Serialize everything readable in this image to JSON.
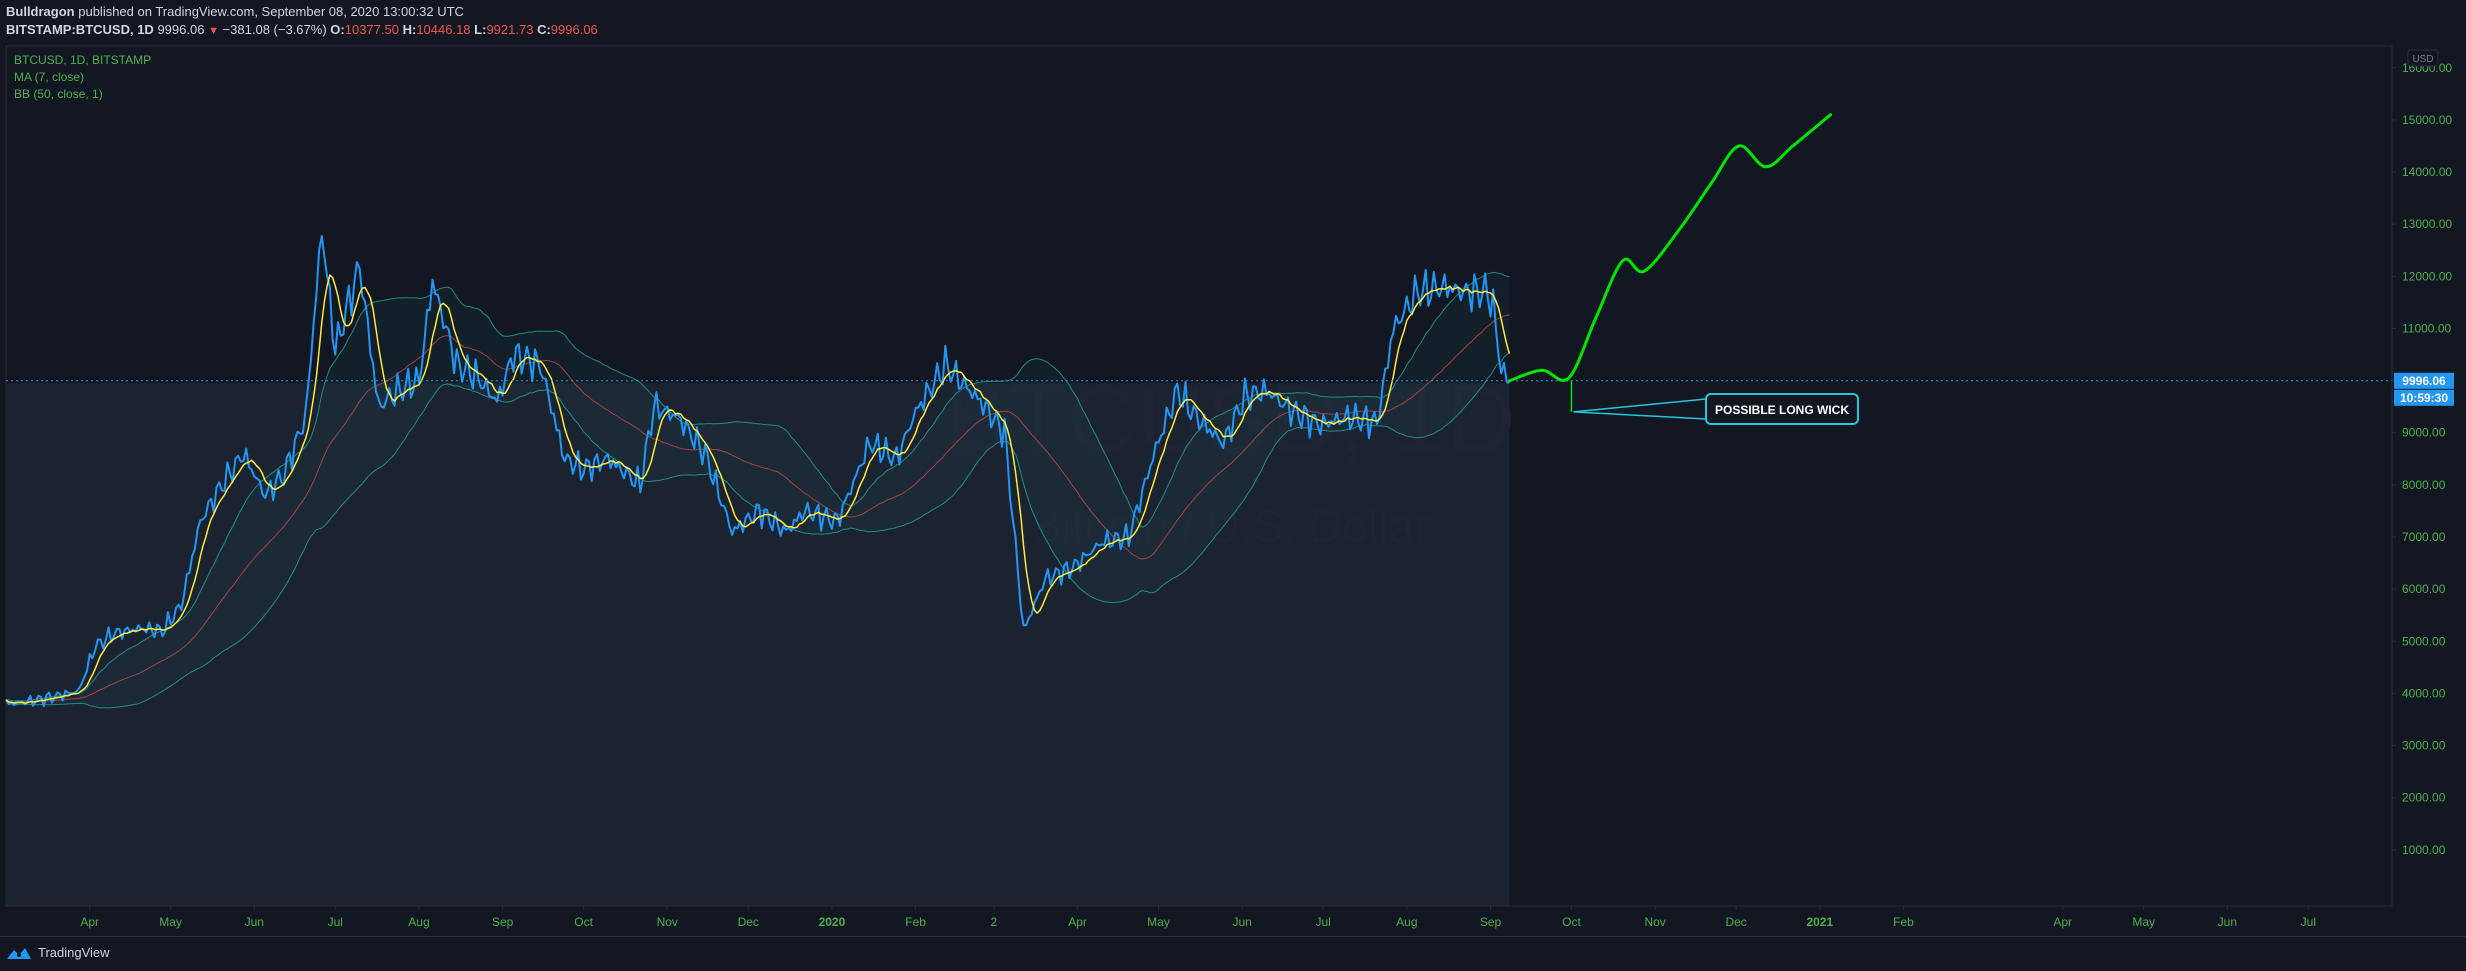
{
  "header": {
    "author": "Bulldragon",
    "published_text": "published on TradingView.com, September 08, 2020 13:00:32 UTC",
    "symbol": "BITSTAMP:BTCUSD, 1D",
    "last": "9996.06",
    "change": "−381.08 (−3.67%)",
    "o_label": "O:",
    "o_value": "10377.50",
    "h_label": "H:",
    "h_value": "10446.18",
    "l_label": "L:",
    "l_value": "9921.73",
    "c_label": "C:",
    "c_value": "9996.06"
  },
  "legend": {
    "line1": "BTCUSD, 1D, BITSTAMP",
    "line2": "MA (7, close)",
    "line3": "BB (50, close, 1)"
  },
  "watermark": {
    "symbol": "BTCUSD, 1D",
    "description": "Bitcoin / U.S. Dollar"
  },
  "annotation": {
    "label": "POSSIBLE LONG WICK"
  },
  "price_badge": {
    "price": "9996.06",
    "countdown": "10:59:30"
  },
  "currency": "USD",
  "footer": {
    "brand": "TradingView"
  },
  "colors": {
    "background": "#131722",
    "price_line": "#2196f3",
    "ma_line": "#ffeb3b",
    "bb_band": "#26a69a",
    "bb_basis": "#b24646",
    "projection": "#00e600",
    "axis_text": "#4caf50",
    "legend_text": "#4caf50",
    "badge": "#2196f3"
  },
  "chart_data": {
    "type": "line",
    "title": "",
    "xlabel": "",
    "ylabel": "",
    "ylim": [
      0,
      16500
    ],
    "y_ticks": [
      1000,
      2000,
      3000,
      4000,
      5000,
      6000,
      7000,
      8000,
      9000,
      10000,
      11000,
      12000,
      13000,
      14000,
      15000,
      16000
    ],
    "y_tick_labels": [
      "1000.00",
      "2000.00",
      "3000.00",
      "4000.00",
      "5000.00",
      "6000.00",
      "7000.00",
      "8000.00",
      "9000.00",
      "10000.00",
      "11000.00",
      "12000.00",
      "13000.00",
      "14000.00",
      "15000.00",
      "16000.00"
    ],
    "x_range": [
      "2019-03-01",
      "2021-08-01"
    ],
    "x_ticks": [
      {
        "date": "2019-04-01",
        "label": "Apr"
      },
      {
        "date": "2019-05-01",
        "label": "May"
      },
      {
        "date": "2019-06-01",
        "label": "Jun"
      },
      {
        "date": "2019-07-01",
        "label": "Jul"
      },
      {
        "date": "2019-08-01",
        "label": "Aug"
      },
      {
        "date": "2019-09-01",
        "label": "Sep"
      },
      {
        "date": "2019-10-01",
        "label": "Oct"
      },
      {
        "date": "2019-11-01",
        "label": "Nov"
      },
      {
        "date": "2019-12-01",
        "label": "Dec"
      },
      {
        "date": "2020-01-01",
        "label": "2020"
      },
      {
        "date": "2020-02-01",
        "label": "Feb"
      },
      {
        "date": "2020-03-01",
        "label": "2"
      },
      {
        "date": "2020-04-01",
        "label": "Apr"
      },
      {
        "date": "2020-05-01",
        "label": "May"
      },
      {
        "date": "2020-06-01",
        "label": "Jun"
      },
      {
        "date": "2020-07-01",
        "label": "Jul"
      },
      {
        "date": "2020-08-01",
        "label": "Aug"
      },
      {
        "date": "2020-09-01",
        "label": "Sep"
      },
      {
        "date": "2020-10-01",
        "label": "Oct"
      },
      {
        "date": "2020-11-01",
        "label": "Nov"
      },
      {
        "date": "2020-12-01",
        "label": "Dec"
      },
      {
        "date": "2021-01-01",
        "label": "2021"
      },
      {
        "date": "2021-02-01",
        "label": "Feb"
      },
      {
        "date": "2021-04-01",
        "label": "Apr"
      },
      {
        "date": "2021-05-01",
        "label": "May"
      },
      {
        "date": "2021-06-01",
        "label": "Jun"
      },
      {
        "date": "2021-07-01",
        "label": "Jul"
      }
    ],
    "last_price": 9996.06,
    "last_date": "2020-09-08",
    "series": [
      {
        "values": [
          [
            "2019-03-01",
            3800
          ],
          [
            "2019-03-10",
            3850
          ],
          [
            "2019-03-20",
            3950
          ],
          [
            "2019-03-28",
            4050
          ],
          [
            "2019-04-03",
            4900
          ],
          [
            "2019-04-10",
            5150
          ],
          [
            "2019-04-20",
            5250
          ],
          [
            "2019-04-28",
            5200
          ],
          [
            "2019-05-05",
            5700
          ],
          [
            "2019-05-12",
            7300
          ],
          [
            "2019-05-20",
            8000
          ],
          [
            "2019-05-28",
            8600
          ],
          [
            "2019-06-05",
            7800
          ],
          [
            "2019-06-12",
            8200
          ],
          [
            "2019-06-20",
            9300
          ],
          [
            "2019-06-26",
            12900
          ],
          [
            "2019-07-01",
            10600
          ],
          [
            "2019-07-10",
            12200
          ],
          [
            "2019-07-17",
            9500
          ],
          [
            "2019-07-24",
            9800
          ],
          [
            "2019-08-01",
            10000
          ],
          [
            "2019-08-06",
            11900
          ],
          [
            "2019-08-15",
            10300
          ],
          [
            "2019-08-22",
            10100
          ],
          [
            "2019-08-30",
            9600
          ],
          [
            "2019-09-05",
            10500
          ],
          [
            "2019-09-15",
            10300
          ],
          [
            "2019-09-24",
            8500
          ],
          [
            "2019-10-01",
            8300
          ],
          [
            "2019-10-10",
            8500
          ],
          [
            "2019-10-22",
            8000
          ],
          [
            "2019-10-27",
            9500
          ],
          [
            "2019-11-05",
            9300
          ],
          [
            "2019-11-15",
            8600
          ],
          [
            "2019-11-25",
            7100
          ],
          [
            "2019-12-05",
            7500
          ],
          [
            "2019-12-15",
            7100
          ],
          [
            "2019-12-22",
            7500
          ],
          [
            "2020-01-03",
            7300
          ],
          [
            "2020-01-15",
            8800
          ],
          [
            "2020-01-25",
            8500
          ],
          [
            "2020-02-01",
            9400
          ],
          [
            "2020-02-12",
            10300
          ],
          [
            "2020-02-25",
            9600
          ],
          [
            "2020-03-05",
            9000
          ],
          [
            "2020-03-12",
            5200
          ],
          [
            "2020-03-20",
            6200
          ],
          [
            "2020-03-30",
            6400
          ],
          [
            "2020-04-10",
            6900
          ],
          [
            "2020-04-20",
            7000
          ],
          [
            "2020-04-30",
            8700
          ],
          [
            "2020-05-08",
            9800
          ],
          [
            "2020-05-15",
            9300
          ],
          [
            "2020-05-25",
            8800
          ],
          [
            "2020-06-02",
            9700
          ],
          [
            "2020-06-10",
            9800
          ],
          [
            "2020-06-20",
            9400
          ],
          [
            "2020-06-30",
            9150
          ],
          [
            "2020-07-10",
            9300
          ],
          [
            "2020-07-21",
            9200
          ],
          [
            "2020-07-27",
            11000
          ],
          [
            "2020-08-05",
            11700
          ],
          [
            "2020-08-15",
            11800
          ],
          [
            "2020-08-22",
            11700
          ],
          [
            "2020-08-31",
            11700
          ],
          [
            "2020-09-02",
            11400
          ],
          [
            "2020-09-05",
            10200
          ],
          [
            "2020-09-08",
            9996
          ]
        ]
      }
    ],
    "projection": {
      "values": [
        [
          "2020-09-08",
          9996
        ],
        [
          "2020-09-20",
          10200
        ],
        [
          "2020-09-30",
          10050
        ],
        [
          "2020-10-10",
          11200
        ],
        [
          "2020-10-20",
          12300
        ],
        [
          "2020-10-28",
          12100
        ],
        [
          "2020-11-10",
          12900
        ],
        [
          "2020-11-22",
          13800
        ],
        [
          "2020-12-02",
          14500
        ],
        [
          "2020-12-12",
          14100
        ],
        [
          "2020-12-22",
          14500
        ],
        [
          "2021-01-05",
          15100
        ]
      ]
    },
    "wick_dates": [
      "2020-10-01"
    ],
    "wick_low": 9400
  }
}
